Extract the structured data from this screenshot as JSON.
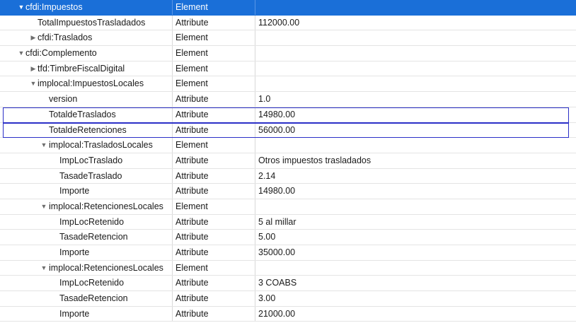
{
  "type_labels": {
    "element": "Element",
    "attribute": "Attribute"
  },
  "icons": {
    "expanded": "▼",
    "collapsed": "▶"
  },
  "rows": [
    {
      "name": "cfdi:Impuestos",
      "type": "Element",
      "value": "",
      "level": 1,
      "toggle": "expanded",
      "state": "selected"
    },
    {
      "name": "TotalImpuestosTrasladados",
      "type": "Attribute",
      "value": "112000.00",
      "level": 2,
      "toggle": "none",
      "state": ""
    },
    {
      "name": "cfdi:Traslados",
      "type": "Element",
      "value": "",
      "level": 2,
      "toggle": "collapsed",
      "state": ""
    },
    {
      "name": "cfdi:Complemento",
      "type": "Element",
      "value": "",
      "level": 1,
      "toggle": "expanded",
      "state": ""
    },
    {
      "name": "tfd:TimbreFiscalDigital",
      "type": "Element",
      "value": "",
      "level": 2,
      "toggle": "collapsed",
      "state": ""
    },
    {
      "name": "implocal:ImpuestosLocales",
      "type": "Element",
      "value": "",
      "level": 2,
      "toggle": "expanded",
      "state": ""
    },
    {
      "name": "version",
      "type": "Attribute",
      "value": "1.0",
      "level": 3,
      "toggle": "none",
      "state": ""
    },
    {
      "name": "TotaldeTraslados",
      "type": "Attribute",
      "value": "14980.00",
      "level": 3,
      "toggle": "none",
      "state": "outlined"
    },
    {
      "name": "TotaldeRetenciones",
      "type": "Attribute",
      "value": "56000.00",
      "level": 3,
      "toggle": "none",
      "state": "outlined"
    },
    {
      "name": "implocal:TrasladosLocales",
      "type": "Element",
      "value": "",
      "level": 3,
      "toggle": "expanded",
      "state": ""
    },
    {
      "name": "ImpLocTraslado",
      "type": "Attribute",
      "value": "Otros impuestos trasladados",
      "level": 4,
      "toggle": "none",
      "state": ""
    },
    {
      "name": "TasadeTraslado",
      "type": "Attribute",
      "value": "2.14",
      "level": 4,
      "toggle": "none",
      "state": ""
    },
    {
      "name": "Importe",
      "type": "Attribute",
      "value": "14980.00",
      "level": 4,
      "toggle": "none",
      "state": ""
    },
    {
      "name": "implocal:RetencionesLocales",
      "type": "Element",
      "value": "",
      "level": 3,
      "toggle": "expanded",
      "state": ""
    },
    {
      "name": "ImpLocRetenido",
      "type": "Attribute",
      "value": "5 al millar",
      "level": 4,
      "toggle": "none",
      "state": ""
    },
    {
      "name": "TasadeRetencion",
      "type": "Attribute",
      "value": "5.00",
      "level": 4,
      "toggle": "none",
      "state": ""
    },
    {
      "name": "Importe",
      "type": "Attribute",
      "value": "35000.00",
      "level": 4,
      "toggle": "none",
      "state": ""
    },
    {
      "name": "implocal:RetencionesLocales",
      "type": "Element",
      "value": "",
      "level": 3,
      "toggle": "expanded",
      "state": ""
    },
    {
      "name": "ImpLocRetenido",
      "type": "Attribute",
      "value": "3 COABS",
      "level": 4,
      "toggle": "none",
      "state": ""
    },
    {
      "name": "TasadeRetencion",
      "type": "Attribute",
      "value": "3.00",
      "level": 4,
      "toggle": "none",
      "state": ""
    },
    {
      "name": "Importe",
      "type": "Attribute",
      "value": "21000.00",
      "level": 4,
      "toggle": "none",
      "state": ""
    }
  ]
}
